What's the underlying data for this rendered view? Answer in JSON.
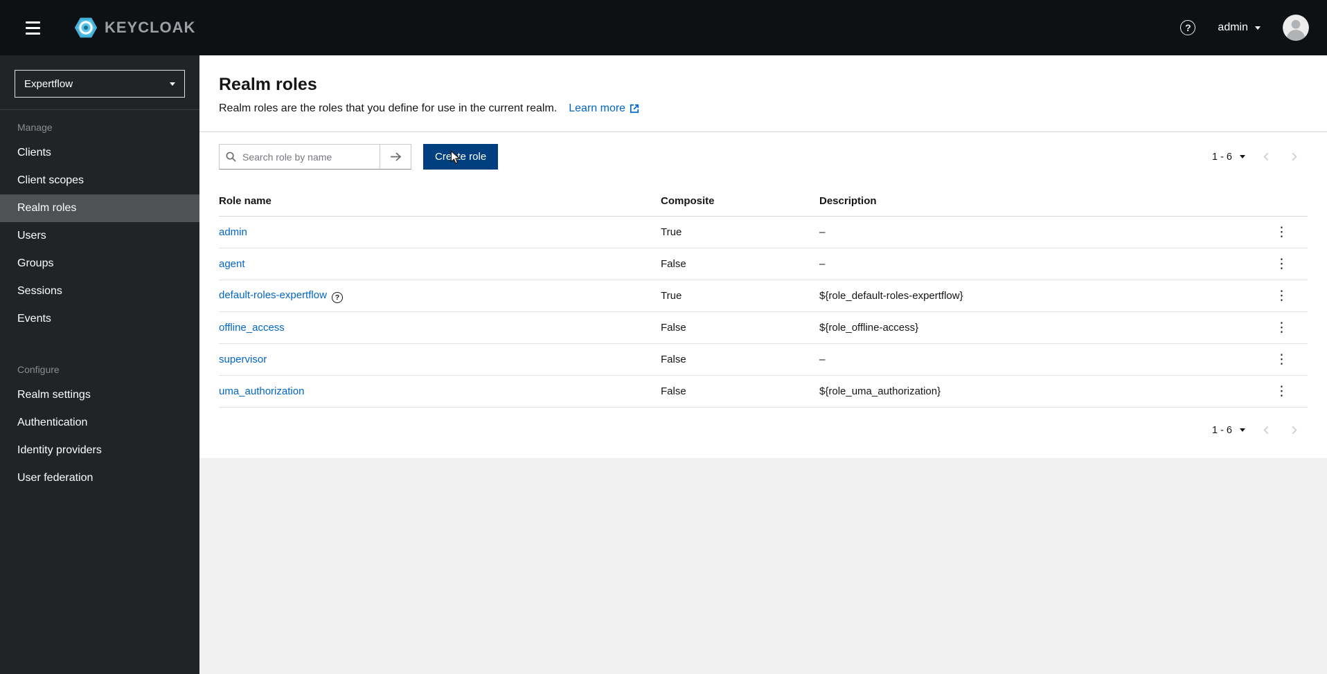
{
  "colors": {
    "masthead_bg": "#0e1114",
    "sidebar_bg": "#212427",
    "sidebar_selected_bg": "#4f5255",
    "link": "#0066cc",
    "primary_button_bg": "#004080",
    "page_bg": "#f0f0f0",
    "brand_icon": "#45b1d8"
  },
  "icons": {
    "nav_toggle": "hamburger-icon",
    "brand": "keycloak-logo-icon",
    "help": "question-circle-icon",
    "user_caret": "caret-down-icon",
    "avatar": "user-avatar-icon",
    "realm_caret": "caret-down-icon",
    "search": "search-icon",
    "search_submit": "arrow-right-icon",
    "external_link": "external-link-icon",
    "pagination_menu": "caret-down-icon",
    "pagination_prev": "chevron-left-icon",
    "pagination_next": "chevron-right-icon",
    "row_help": "question-circle-icon",
    "row_actions": "kebab-vertical-icon"
  },
  "header": {
    "brand": "KEYCLOAK",
    "user": "admin"
  },
  "sidebar": {
    "realm": "Expertflow",
    "groups": [
      {
        "label": "Manage",
        "items": [
          {
            "label": "Clients",
            "selected": false
          },
          {
            "label": "Client scopes",
            "selected": false
          },
          {
            "label": "Realm roles",
            "selected": true
          },
          {
            "label": "Users",
            "selected": false
          },
          {
            "label": "Groups",
            "selected": false
          },
          {
            "label": "Sessions",
            "selected": false
          },
          {
            "label": "Events",
            "selected": false
          }
        ]
      },
      {
        "label": "Configure",
        "items": [
          {
            "label": "Realm settings",
            "selected": false
          },
          {
            "label": "Authentication",
            "selected": false
          },
          {
            "label": "Identity providers",
            "selected": false
          },
          {
            "label": "User federation",
            "selected": false
          }
        ]
      }
    ]
  },
  "page": {
    "title": "Realm roles",
    "description": "Realm roles are the roles that you define for use in the current realm.",
    "learn_more_label": "Learn more"
  },
  "toolbar": {
    "search_placeholder": "Search role by name",
    "create_button_label": "Create role"
  },
  "pagination": {
    "range": "1 - 6"
  },
  "table": {
    "columns": [
      "Role name",
      "Composite",
      "Description"
    ],
    "rows": [
      {
        "name": "admin",
        "composite": "True",
        "description": "–",
        "help": false
      },
      {
        "name": "agent",
        "composite": "False",
        "description": "–",
        "help": false
      },
      {
        "name": "default-roles-expertflow",
        "composite": "True",
        "description": "${role_default-roles-expertflow}",
        "help": true
      },
      {
        "name": "offline_access",
        "composite": "False",
        "description": "${role_offline-access}",
        "help": false
      },
      {
        "name": "supervisor",
        "composite": "False",
        "description": "–",
        "help": false
      },
      {
        "name": "uma_authorization",
        "composite": "False",
        "description": "${role_uma_authorization}",
        "help": false
      }
    ]
  }
}
